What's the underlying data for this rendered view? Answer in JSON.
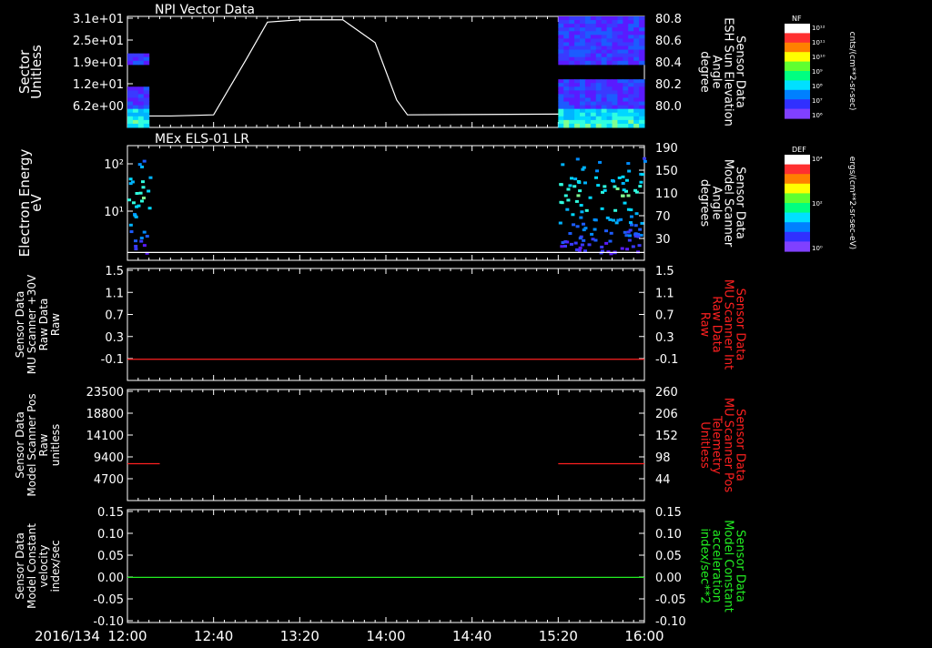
{
  "date_label": "2016/134",
  "time_ticks": [
    "12:00",
    "12:40",
    "13:20",
    "14:00",
    "14:40",
    "15:20",
    "16:00"
  ],
  "colors": {
    "fg": "#ffffff",
    "red": "#ff2020",
    "green": "#22ee22"
  },
  "panels": [
    {
      "id": "npi",
      "title": "NPI Vector Data",
      "left_label": [
        "Sector",
        "Unitless"
      ],
      "left_ticks": [
        "3.1e+01",
        "2.5e+01",
        "1.9e+01",
        "1.2e+01",
        "6.2e+00"
      ],
      "right_label": [
        "Sensor Data",
        "ESH Sun Elevation",
        "Angle",
        "degree"
      ],
      "right_ticks": [
        "80.8",
        "80.6",
        "80.4",
        "80.2",
        "80.0"
      ],
      "right_label_color": "white"
    },
    {
      "id": "els",
      "title": "MEx ELS-01 LR",
      "left_label": [
        "Electron Energy",
        "eV"
      ],
      "left_ticks": [
        "10²",
        "10¹"
      ],
      "right_label": [
        "Sensor Data",
        "Model Scanner",
        "Angle",
        "degrees"
      ],
      "right_ticks": [
        "190",
        "150",
        "110",
        "70",
        "30"
      ],
      "right_label_color": "white"
    },
    {
      "id": "mu_raw",
      "title": "",
      "left_label": [
        "Sensor Data",
        "MU Scanner +30V",
        "Raw Data",
        "Raw"
      ],
      "left_ticks": [
        "1.5",
        "1.1",
        "0.7",
        "0.3",
        "-0.1"
      ],
      "right_label": [
        "Sensor Data",
        "MU Scanner Int",
        "Raw Data",
        "Raw"
      ],
      "right_ticks": [
        "1.5",
        "1.1",
        "0.7",
        "0.3",
        "-0.1"
      ],
      "right_label_color": "red"
    },
    {
      "id": "scan_pos",
      "title": "",
      "left_label": [
        "Sensor Data",
        "Model Scanner Pos",
        "Raw",
        "unitless"
      ],
      "left_ticks": [
        "23500",
        "18800",
        "14100",
        "9400",
        "4700"
      ],
      "right_label": [
        "Sensor Data",
        "MU Scanner Pos",
        "Telemetry",
        "Unitless"
      ],
      "right_ticks": [
        "260",
        "206",
        "152",
        "98",
        "44"
      ],
      "right_label_color": "red"
    },
    {
      "id": "velocity",
      "title": "",
      "left_label": [
        "Sensor Data",
        "Model Constant",
        "velocity",
        "index/sec"
      ],
      "left_ticks": [
        "0.15",
        "0.10",
        "0.05",
        "0.00",
        "-0.05",
        "-0.10"
      ],
      "right_label": [
        "Sensor Data",
        "Model Constant",
        "acceleration",
        "index/sec**2"
      ],
      "right_ticks": [
        "0.15",
        "0.10",
        "0.05",
        "0.00",
        "-0.05",
        "-0.10"
      ],
      "right_label_color": "green"
    }
  ],
  "colorbars": [
    {
      "id": "nf",
      "title": "NF",
      "unit": "cnts/(cm**2-sr-sec)",
      "ticks": [
        "10¹²",
        "10¹¹",
        "10¹⁰",
        "10⁹",
        "10⁸",
        "10⁷",
        "10⁶"
      ]
    },
    {
      "id": "def",
      "title": "DEF",
      "unit": "ergs/(cm**2-sr-sec-eV)",
      "ticks": [
        "10⁴",
        "10²",
        "10⁰"
      ]
    }
  ],
  "chart_data": [
    {
      "type": "line",
      "panel": "npi",
      "series_axis": "right",
      "x": [
        "12:00",
        "12:20",
        "12:40",
        "12:55",
        "13:05",
        "13:20",
        "13:40",
        "13:55",
        "14:05",
        "14:10",
        "16:00"
      ],
      "values": [
        79.96,
        79.96,
        79.97,
        80.45,
        80.78,
        80.8,
        80.8,
        80.6,
        80.1,
        79.97,
        79.98
      ],
      "ylim": [
        79.86,
        80.83
      ]
    },
    {
      "type": "heatmap",
      "panel": "npi",
      "note_series": "Sector vs time",
      "x_ranges": [
        [
          "12:00",
          "12:10"
        ],
        [
          "15:20",
          "16:00"
        ]
      ],
      "ylim": [
        0,
        31
      ]
    },
    {
      "type": "heatmap",
      "panel": "els",
      "x_ranges": [
        [
          "12:00",
          "12:10"
        ],
        [
          "15:20",
          "16:00"
        ]
      ],
      "ylim": [
        1,
        200
      ]
    },
    {
      "type": "line",
      "panel": "els",
      "series_axis": "right",
      "x": [
        "12:00",
        "16:00"
      ],
      "values": [
        13,
        13
      ],
      "ylim": [
        0,
        190
      ]
    },
    {
      "type": "line",
      "panel": "mu_raw",
      "color": "red",
      "x": [
        "12:00",
        "16:00"
      ],
      "values": [
        0,
        0
      ],
      "ylim": [
        -0.35,
        1.5
      ]
    },
    {
      "type": "line",
      "panel": "scan_pos",
      "color": "red",
      "segments": [
        {
          "x": [
            "12:00",
            "12:15"
          ],
          "values": [
            7800,
            7800
          ]
        },
        {
          "x": [
            "15:20",
            "16:00"
          ],
          "values": [
            7800,
            7800
          ]
        }
      ],
      "ylim": [
        0,
        23500
      ]
    },
    {
      "type": "line",
      "panel": "velocity",
      "color": "green",
      "x": [
        "12:00",
        "16:00"
      ],
      "values": [
        0,
        0
      ],
      "ylim": [
        -0.1,
        0.15
      ]
    }
  ]
}
